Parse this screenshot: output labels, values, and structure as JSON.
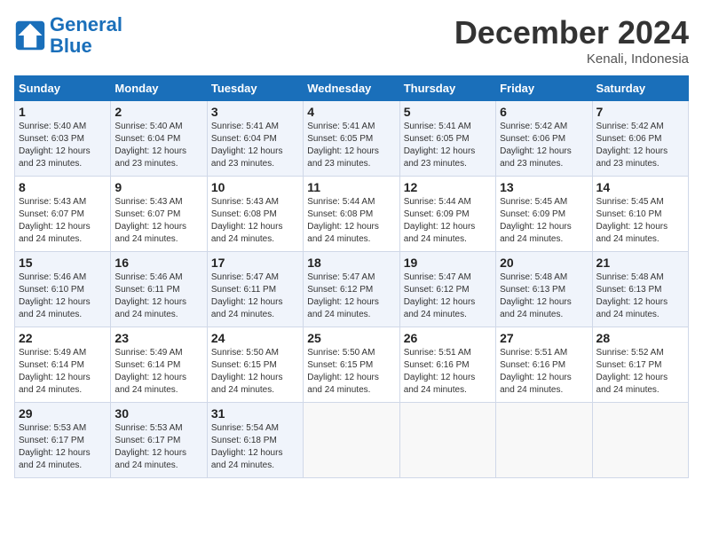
{
  "header": {
    "logo_line1": "General",
    "logo_line2": "Blue",
    "month": "December 2024",
    "location": "Kenali, Indonesia"
  },
  "weekdays": [
    "Sunday",
    "Monday",
    "Tuesday",
    "Wednesday",
    "Thursday",
    "Friday",
    "Saturday"
  ],
  "weeks": [
    [
      {
        "day": "1",
        "sunrise": "5:40 AM",
        "sunset": "6:03 PM",
        "daylight": "12 hours and 23 minutes."
      },
      {
        "day": "2",
        "sunrise": "5:40 AM",
        "sunset": "6:04 PM",
        "daylight": "12 hours and 23 minutes."
      },
      {
        "day": "3",
        "sunrise": "5:41 AM",
        "sunset": "6:04 PM",
        "daylight": "12 hours and 23 minutes."
      },
      {
        "day": "4",
        "sunrise": "5:41 AM",
        "sunset": "6:05 PM",
        "daylight": "12 hours and 23 minutes."
      },
      {
        "day": "5",
        "sunrise": "5:41 AM",
        "sunset": "6:05 PM",
        "daylight": "12 hours and 23 minutes."
      },
      {
        "day": "6",
        "sunrise": "5:42 AM",
        "sunset": "6:06 PM",
        "daylight": "12 hours and 23 minutes."
      },
      {
        "day": "7",
        "sunrise": "5:42 AM",
        "sunset": "6:06 PM",
        "daylight": "12 hours and 23 minutes."
      }
    ],
    [
      {
        "day": "8",
        "sunrise": "5:43 AM",
        "sunset": "6:07 PM",
        "daylight": "12 hours and 24 minutes."
      },
      {
        "day": "9",
        "sunrise": "5:43 AM",
        "sunset": "6:07 PM",
        "daylight": "12 hours and 24 minutes."
      },
      {
        "day": "10",
        "sunrise": "5:43 AM",
        "sunset": "6:08 PM",
        "daylight": "12 hours and 24 minutes."
      },
      {
        "day": "11",
        "sunrise": "5:44 AM",
        "sunset": "6:08 PM",
        "daylight": "12 hours and 24 minutes."
      },
      {
        "day": "12",
        "sunrise": "5:44 AM",
        "sunset": "6:09 PM",
        "daylight": "12 hours and 24 minutes."
      },
      {
        "day": "13",
        "sunrise": "5:45 AM",
        "sunset": "6:09 PM",
        "daylight": "12 hours and 24 minutes."
      },
      {
        "day": "14",
        "sunrise": "5:45 AM",
        "sunset": "6:10 PM",
        "daylight": "12 hours and 24 minutes."
      }
    ],
    [
      {
        "day": "15",
        "sunrise": "5:46 AM",
        "sunset": "6:10 PM",
        "daylight": "12 hours and 24 minutes."
      },
      {
        "day": "16",
        "sunrise": "5:46 AM",
        "sunset": "6:11 PM",
        "daylight": "12 hours and 24 minutes."
      },
      {
        "day": "17",
        "sunrise": "5:47 AM",
        "sunset": "6:11 PM",
        "daylight": "12 hours and 24 minutes."
      },
      {
        "day": "18",
        "sunrise": "5:47 AM",
        "sunset": "6:12 PM",
        "daylight": "12 hours and 24 minutes."
      },
      {
        "day": "19",
        "sunrise": "5:47 AM",
        "sunset": "6:12 PM",
        "daylight": "12 hours and 24 minutes."
      },
      {
        "day": "20",
        "sunrise": "5:48 AM",
        "sunset": "6:13 PM",
        "daylight": "12 hours and 24 minutes."
      },
      {
        "day": "21",
        "sunrise": "5:48 AM",
        "sunset": "6:13 PM",
        "daylight": "12 hours and 24 minutes."
      }
    ],
    [
      {
        "day": "22",
        "sunrise": "5:49 AM",
        "sunset": "6:14 PM",
        "daylight": "12 hours and 24 minutes."
      },
      {
        "day": "23",
        "sunrise": "5:49 AM",
        "sunset": "6:14 PM",
        "daylight": "12 hours and 24 minutes."
      },
      {
        "day": "24",
        "sunrise": "5:50 AM",
        "sunset": "6:15 PM",
        "daylight": "12 hours and 24 minutes."
      },
      {
        "day": "25",
        "sunrise": "5:50 AM",
        "sunset": "6:15 PM",
        "daylight": "12 hours and 24 minutes."
      },
      {
        "day": "26",
        "sunrise": "5:51 AM",
        "sunset": "6:16 PM",
        "daylight": "12 hours and 24 minutes."
      },
      {
        "day": "27",
        "sunrise": "5:51 AM",
        "sunset": "6:16 PM",
        "daylight": "12 hours and 24 minutes."
      },
      {
        "day": "28",
        "sunrise": "5:52 AM",
        "sunset": "6:17 PM",
        "daylight": "12 hours and 24 minutes."
      }
    ],
    [
      {
        "day": "29",
        "sunrise": "5:53 AM",
        "sunset": "6:17 PM",
        "daylight": "12 hours and 24 minutes."
      },
      {
        "day": "30",
        "sunrise": "5:53 AM",
        "sunset": "6:17 PM",
        "daylight": "12 hours and 24 minutes."
      },
      {
        "day": "31",
        "sunrise": "5:54 AM",
        "sunset": "6:18 PM",
        "daylight": "12 hours and 24 minutes."
      },
      null,
      null,
      null,
      null
    ]
  ]
}
